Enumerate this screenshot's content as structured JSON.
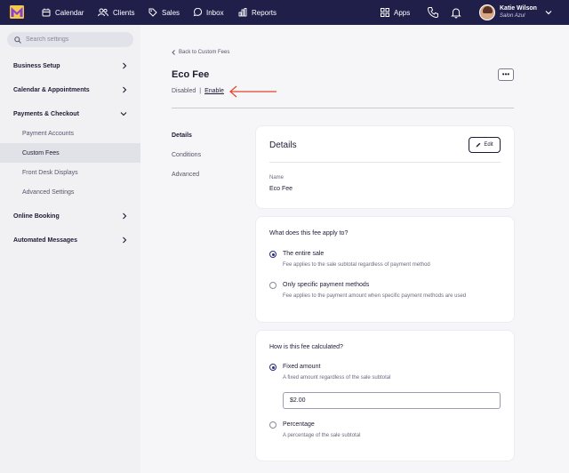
{
  "topbar": {
    "nav": [
      {
        "label": "Calendar",
        "icon": "calendar-icon"
      },
      {
        "label": "Clients",
        "icon": "clients-icon"
      },
      {
        "label": "Sales",
        "icon": "sales-tag-icon"
      },
      {
        "label": "Inbox",
        "icon": "inbox-chat-icon"
      },
      {
        "label": "Reports",
        "icon": "reports-chart-icon"
      },
      {
        "label": "Apps",
        "icon": "apps-grid-icon"
      }
    ],
    "user": {
      "name": "Katie Wilson",
      "salon": "Salon Azul"
    }
  },
  "sidebar": {
    "search_placeholder": "Search settings",
    "items": [
      {
        "label": "Business Setup"
      },
      {
        "label": "Calendar & Appointments"
      },
      {
        "label": "Payments & Checkout",
        "expanded": true
      },
      {
        "label": "Online Booking"
      },
      {
        "label": "Automated Messages"
      }
    ],
    "subitems": [
      {
        "label": "Payment Accounts"
      },
      {
        "label": "Custom Fees",
        "active": true
      },
      {
        "label": "Front Desk Displays"
      },
      {
        "label": "Advanced Settings"
      }
    ]
  },
  "main": {
    "back_label": "Back to Custom Fees",
    "title": "Eco Fee",
    "more_label": "•••",
    "status": "Disabled",
    "separator": "|",
    "enable_label": "Enable",
    "arrow_color": "#e0442b",
    "tabs": [
      {
        "label": "Details",
        "active": true
      },
      {
        "label": "Conditions"
      },
      {
        "label": "Advanced"
      }
    ],
    "details_card": {
      "title": "Details",
      "edit_label": "Edit",
      "name_label": "Name",
      "name_value": "Eco Fee"
    },
    "applies_card": {
      "question": "What does this fee apply to?",
      "options": [
        {
          "label": "The entire sale",
          "desc": "Fee applies to the sale subtotal regardless of payment method",
          "selected": true
        },
        {
          "label": "Only specific payment methods",
          "desc": "Fee applies to the payment amount when specific payment methods are used",
          "selected": false
        }
      ]
    },
    "calc_card": {
      "question": "How is this fee calculated?",
      "options": [
        {
          "label": "Fixed amount",
          "desc": "A fixed amount regardless of the sale subtotal",
          "selected": true
        },
        {
          "label": "Percentage",
          "desc": "A percentage of the sale subtotal",
          "selected": false
        }
      ],
      "amount_value": "$2.00"
    }
  }
}
